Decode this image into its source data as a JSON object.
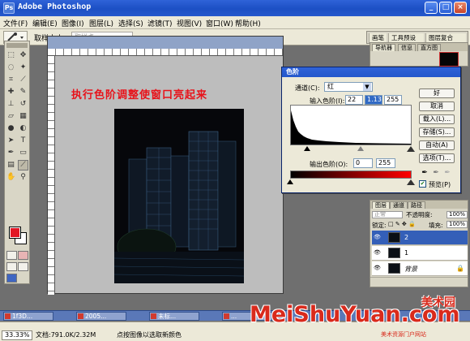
{
  "window": {
    "title": "Adobe Photoshop"
  },
  "menu": [
    "文件(F)",
    "编辑(E)",
    "图像(I)",
    "图层(L)",
    "选择(S)",
    "滤镜(T)",
    "视图(V)",
    "窗口(W)",
    "帮助(H)"
  ],
  "options_bar": {
    "sample_label": "取样大小:",
    "sample_value": "取样点",
    "palette_tabs": [
      "画笔",
      "工具预设",
      "图层复合"
    ]
  },
  "document": {
    "overlay_text": "执行色阶调整使窗口亮起来"
  },
  "levels": {
    "title": "色阶",
    "channel_label": "通道(C):",
    "channel_value": "红",
    "input_label": "输入色阶(I):",
    "input_values": [
      "22",
      "1.13",
      "255"
    ],
    "output_label": "输出色阶(O):",
    "output_values": [
      "0",
      "255"
    ],
    "buttons": [
      "好",
      "取消",
      "载入(L)...",
      "存储(S)...",
      "自动(A)",
      "选项(T)..."
    ],
    "preview_label": "预览(P)",
    "preview_checked": true
  },
  "navigator": {
    "tabs": [
      "导航器",
      "信息",
      "直方图"
    ]
  },
  "layers": {
    "tabs": [
      "图层",
      "通道",
      "路径"
    ],
    "blend_mode": "正常",
    "opacity_label": "不透明度:",
    "opacity_value": "100%",
    "lock_label": "锁定:",
    "fill_label": "填充:",
    "fill_value": "100%",
    "items": [
      {
        "name": "2",
        "selected": true
      },
      {
        "name": "1",
        "selected": false
      },
      {
        "name": "背景",
        "selected": false
      }
    ]
  },
  "taskbar": {
    "items": [
      "1f3D...",
      "2005...",
      "未标...",
      "..."
    ]
  },
  "status": {
    "zoom": "33.33%",
    "doc": "文档:791.0K/2.32M",
    "message": "点按图像以选取新颜色"
  },
  "watermark": {
    "latin": "MeiShuYuan.com",
    "cn": "美术园",
    "sub": "美术资源门户网站"
  },
  "colors": {
    "accent": "#2f63d8",
    "foreground": "#e21624",
    "watermark": "#d92a1c"
  }
}
